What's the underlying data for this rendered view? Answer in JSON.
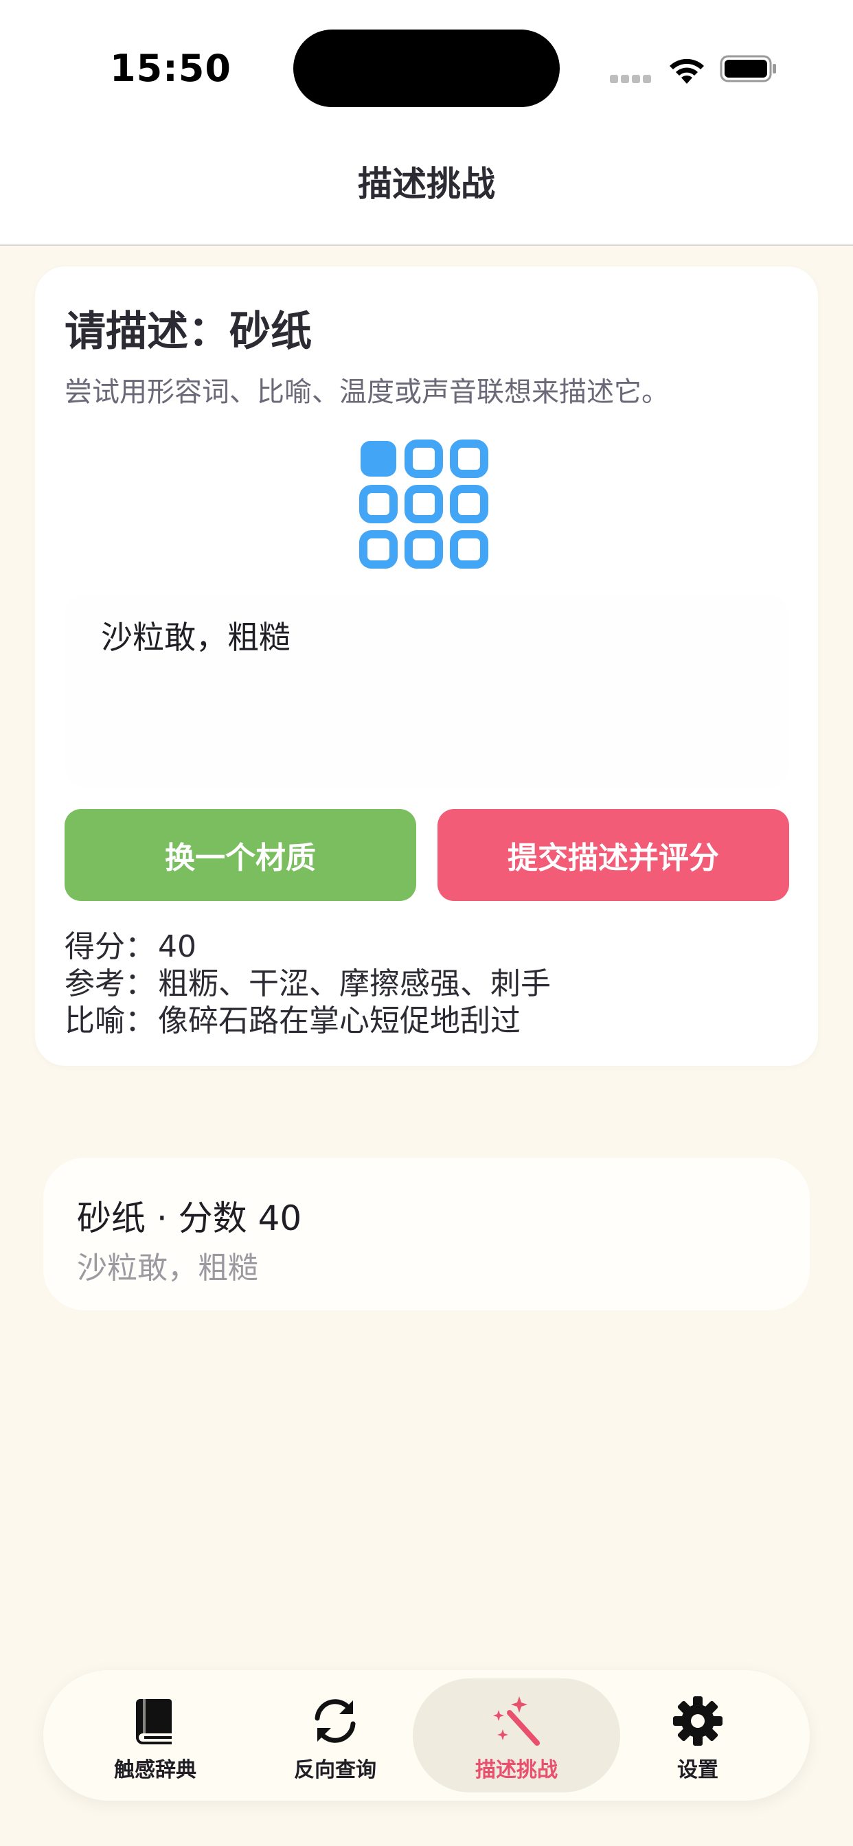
{
  "status_bar": {
    "time": "15:50"
  },
  "nav": {
    "title": "描述挑战"
  },
  "challenge": {
    "title": "请描述：砂纸",
    "hint": "尝试用形容词、比喻、温度或声音联想来描述它。",
    "icon": "grid-icon",
    "answer_text": "沙粒敢，粗糙",
    "buttons": {
      "change": "换一个材质",
      "submit": "提交描述并评分"
    },
    "result": {
      "score_label": "得分：",
      "score_value": "40",
      "reference_label": "参考：",
      "reference_value": "粗粝、干涩、摩擦感强、刺手",
      "metaphor_label": "比喻：",
      "metaphor_value": "像碎石路在掌心短促地刮过"
    }
  },
  "history": [
    {
      "title": "砂纸 · 分数 40",
      "subtitle": "沙粒敢，粗糙"
    }
  ],
  "tabs": [
    {
      "label": "触感辞典",
      "icon": "book-icon",
      "active": false
    },
    {
      "label": "反向查询",
      "icon": "refresh-icon",
      "active": false
    },
    {
      "label": "描述挑战",
      "icon": "magic-wand-icon",
      "active": true
    },
    {
      "label": "设置",
      "icon": "gear-icon",
      "active": false
    }
  ],
  "colors": {
    "background": "#FCF8EE",
    "accent_green": "#7BBE60",
    "accent_red": "#F25C77",
    "icon_blue": "#42A5F5",
    "active_tab": "#E8506E"
  }
}
